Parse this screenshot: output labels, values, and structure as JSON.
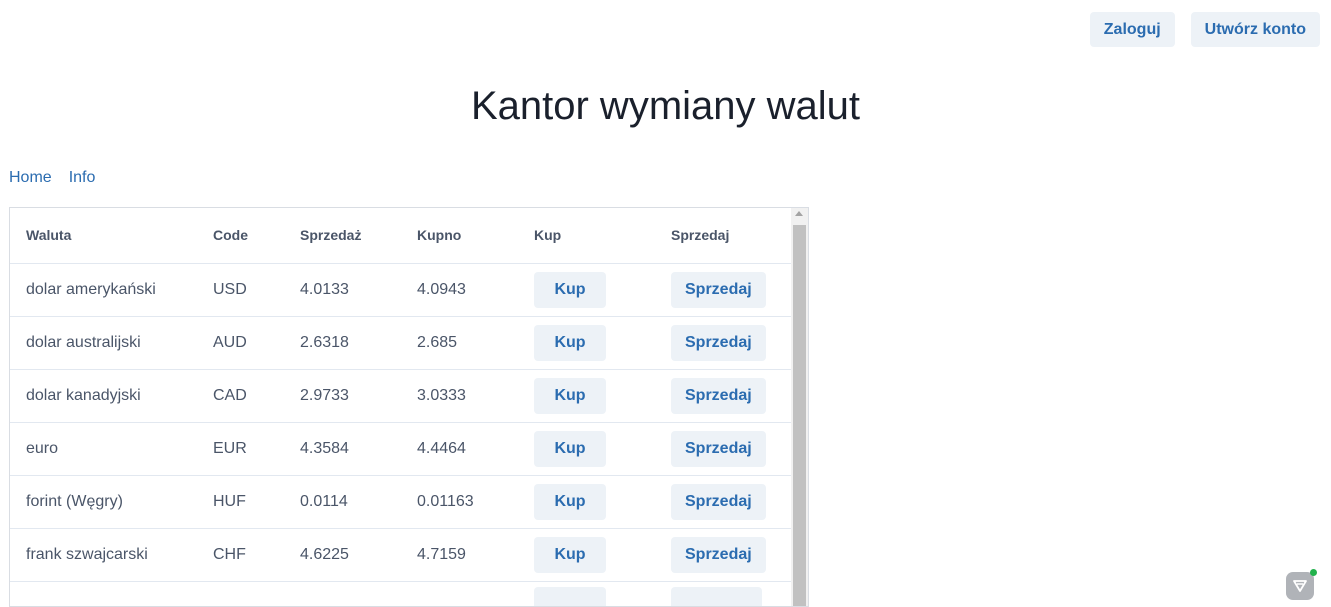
{
  "header": {
    "login_label": "Zaloguj",
    "register_label": "Utwórz konto"
  },
  "page": {
    "title": "Kantor wymiany walut"
  },
  "nav": {
    "home": "Home",
    "info": "Info"
  },
  "table": {
    "columns": {
      "currency": "Waluta",
      "code": "Code",
      "sell_rate": "Sprzedaż",
      "buy_rate": "Kupno",
      "buy": "Kup",
      "sell": "Sprzedaj"
    },
    "rows": [
      {
        "name": "dolar amerykański",
        "code": "USD",
        "sell": "4.0133",
        "buy": "4.0943",
        "buy_btn": "Kup",
        "sell_btn": "Sprzedaj"
      },
      {
        "name": "dolar australijski",
        "code": "AUD",
        "sell": "2.6318",
        "buy": "2.685",
        "buy_btn": "Kup",
        "sell_btn": "Sprzedaj"
      },
      {
        "name": "dolar kanadyjski",
        "code": "CAD",
        "sell": "2.9733",
        "buy": "3.0333",
        "buy_btn": "Kup",
        "sell_btn": "Sprzedaj"
      },
      {
        "name": "euro",
        "code": "EUR",
        "sell": "4.3584",
        "buy": "4.4464",
        "buy_btn": "Kup",
        "sell_btn": "Sprzedaj"
      },
      {
        "name": "forint (Węgry)",
        "code": "HUF",
        "sell": "0.0114",
        "buy": "0.01163",
        "buy_btn": "Kup",
        "sell_btn": "Sprzedaj"
      },
      {
        "name": "frank szwajcarski",
        "code": "CHF",
        "sell": "4.6225",
        "buy": "4.7159",
        "buy_btn": "Kup",
        "sell_btn": "Sprzedaj"
      },
      {
        "name": "",
        "code": "",
        "sell": "",
        "buy": "",
        "buy_btn": "",
        "sell_btn": ""
      }
    ]
  },
  "widget": {
    "icon": "chat-widget-icon",
    "status_color": "#22b14c"
  }
}
